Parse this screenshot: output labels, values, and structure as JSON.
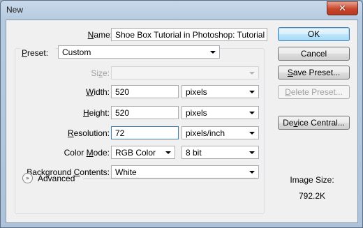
{
  "window": {
    "title": "New",
    "close_glyph": "✕"
  },
  "fields": {
    "name": {
      "label_u": "N",
      "label_rest": "ame:",
      "value": "Shoe Box Tutorial in Photoshop: Tutorial"
    },
    "preset": {
      "label_u": "P",
      "label_rest": "reset:",
      "value": "Custom"
    },
    "size": {
      "label_pre": "Si",
      "label_u": "z",
      "label_rest": "e:",
      "value": ""
    },
    "width": {
      "label_u": "W",
      "label_rest": "idth:",
      "value": "520",
      "unit": "pixels"
    },
    "height": {
      "label_u": "H",
      "label_rest": "eight:",
      "value": "520",
      "unit": "pixels"
    },
    "resolution": {
      "label_u": "R",
      "label_rest": "esolution:",
      "value": "72",
      "unit": "pixels/inch"
    },
    "color_mode": {
      "label_pre": "Color ",
      "label_u": "M",
      "label_rest": "ode:",
      "value": "RGB Color",
      "depth": "8 bit"
    },
    "background": {
      "label_pre": "Background ",
      "label_u": "C",
      "label_rest": "ontents:",
      "value": "White"
    }
  },
  "advanced": {
    "label": "Advanced",
    "icon": "»"
  },
  "buttons": {
    "ok": "OK",
    "cancel": "Cancel",
    "save_preset_u": "S",
    "save_preset_rest": "ave Preset...",
    "delete_preset_u": "D",
    "delete_preset_rest": "elete Preset...",
    "device_central_pre": "De",
    "device_central_u": "v",
    "device_central_rest": "ice Central..."
  },
  "image_size": {
    "label": "Image Size:",
    "value": "792.2K"
  },
  "colors": {
    "title_bar": "#b7cbe0",
    "close_button": "#c8462b",
    "focus_border": "#3c7fb1"
  }
}
